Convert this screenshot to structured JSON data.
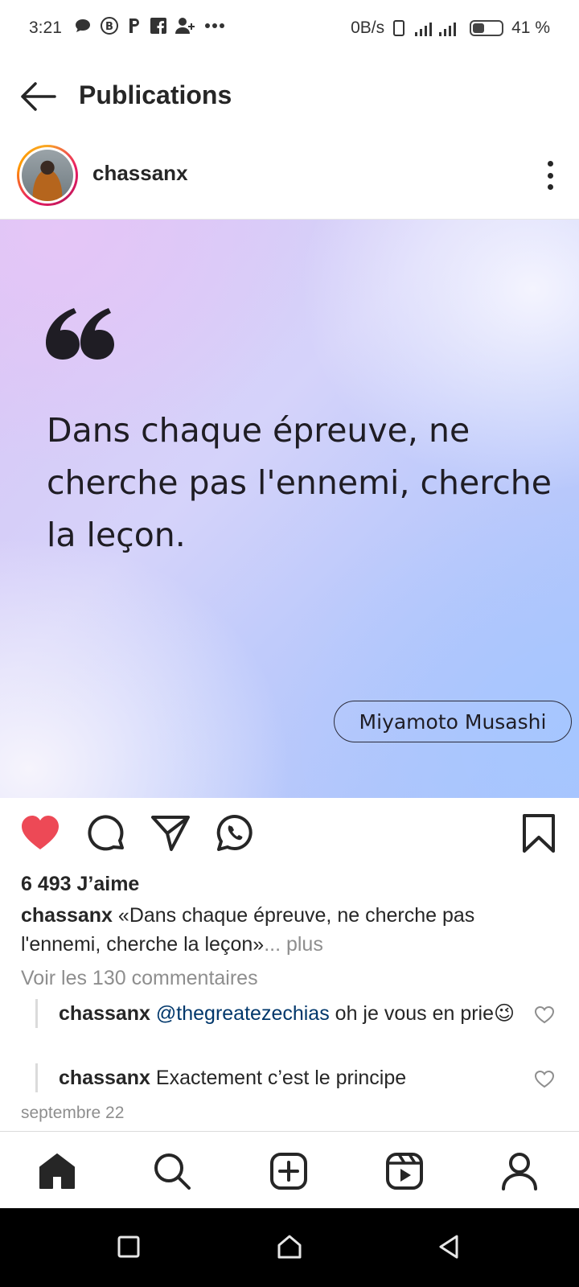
{
  "status_bar": {
    "time": "3:21",
    "left_icons": [
      "chat-icon",
      "b-circle-icon",
      "p-icon",
      "facebook-icon",
      "add-user-icon",
      "more-dots-icon"
    ],
    "speed": "0B/s",
    "battery_percent": "41 %",
    "battery_level": 0.41
  },
  "header": {
    "title": "Publications"
  },
  "post": {
    "username": "chassanx",
    "quote_text": "Dans chaque épreuve, ne cherche pas l'ennemi, cherche la leçon.",
    "quote_author": "Miyamoto Musashi",
    "likes": "6 493 J’aime",
    "caption_user": "chassanx",
    "caption_text": " «Dans chaque épreuve, ne cherche pas l'ennemi, cherche la leçon»",
    "caption_more": "... plus",
    "view_comments": "Voir les 130 commentaires",
    "comments": [
      {
        "user": "chassanx",
        "mention": "@thegreatezechias",
        "text": " oh je vous en prie😉"
      },
      {
        "user": "chassanx",
        "mention": "",
        "text": " Exactement c’est le principe"
      }
    ],
    "date": "septembre 22"
  },
  "colors": {
    "heart": "#ed4956",
    "mention": "#00376b",
    "muted": "#8e8e8e"
  },
  "bottom_nav": [
    "home-icon",
    "search-icon",
    "add-post-icon",
    "reels-icon",
    "profile-icon"
  ],
  "system_nav": [
    "recents-icon",
    "home-icon",
    "back-icon"
  ]
}
